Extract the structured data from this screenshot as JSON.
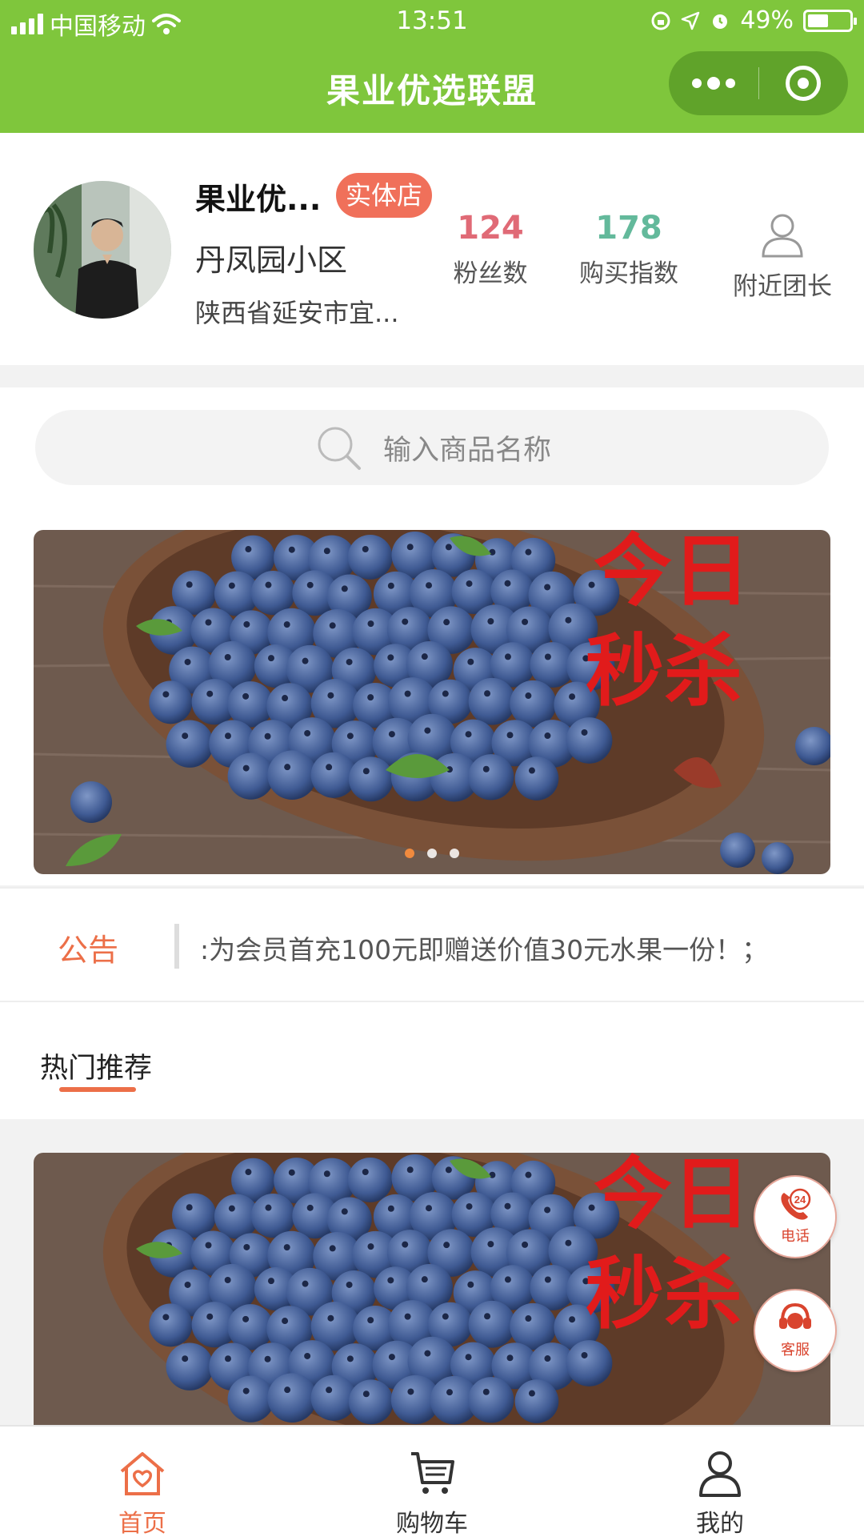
{
  "status_bar": {
    "carrier": "中国移动",
    "time": "13:51",
    "battery_percent": "49%",
    "battery_level": 0.49
  },
  "nav": {
    "title": "果业优选联盟",
    "more_icon": "more-dots-icon",
    "close_icon": "target-circle-icon"
  },
  "profile": {
    "shop_name": "果业优...",
    "badge": "实体店",
    "community": "丹凤园小区",
    "address": "陕西省延安市宜...",
    "stats": [
      {
        "value": "124",
        "label": "粉丝数"
      },
      {
        "value": "178",
        "label": "购买指数"
      }
    ],
    "nearby_label": "附近团长",
    "colors": {
      "fans": "#e06a76",
      "buy": "#63b99b",
      "badge": "#f0705a"
    }
  },
  "search": {
    "placeholder": "输入商品名称"
  },
  "banner": {
    "text_line1": "今日",
    "text_line2": "秒杀",
    "dots": 3,
    "active_dot": 0
  },
  "notice": {
    "label": "公告",
    "text": ":为会员首充100元即赠送价值30元水果一份！；"
  },
  "hot": {
    "title": "热门推荐"
  },
  "banner2": {
    "text_line1": "今日",
    "text_line2": "秒杀"
  },
  "fabs": {
    "phone_label": "电话",
    "phone_badge": "24",
    "service_label": "客服"
  },
  "tabbar": {
    "home": "首页",
    "cart": "购物车",
    "mine": "我的",
    "active": "home",
    "active_color": "#ec6f48"
  },
  "theme": {
    "primary": "#7fc63c",
    "accent": "#ec6f48"
  }
}
